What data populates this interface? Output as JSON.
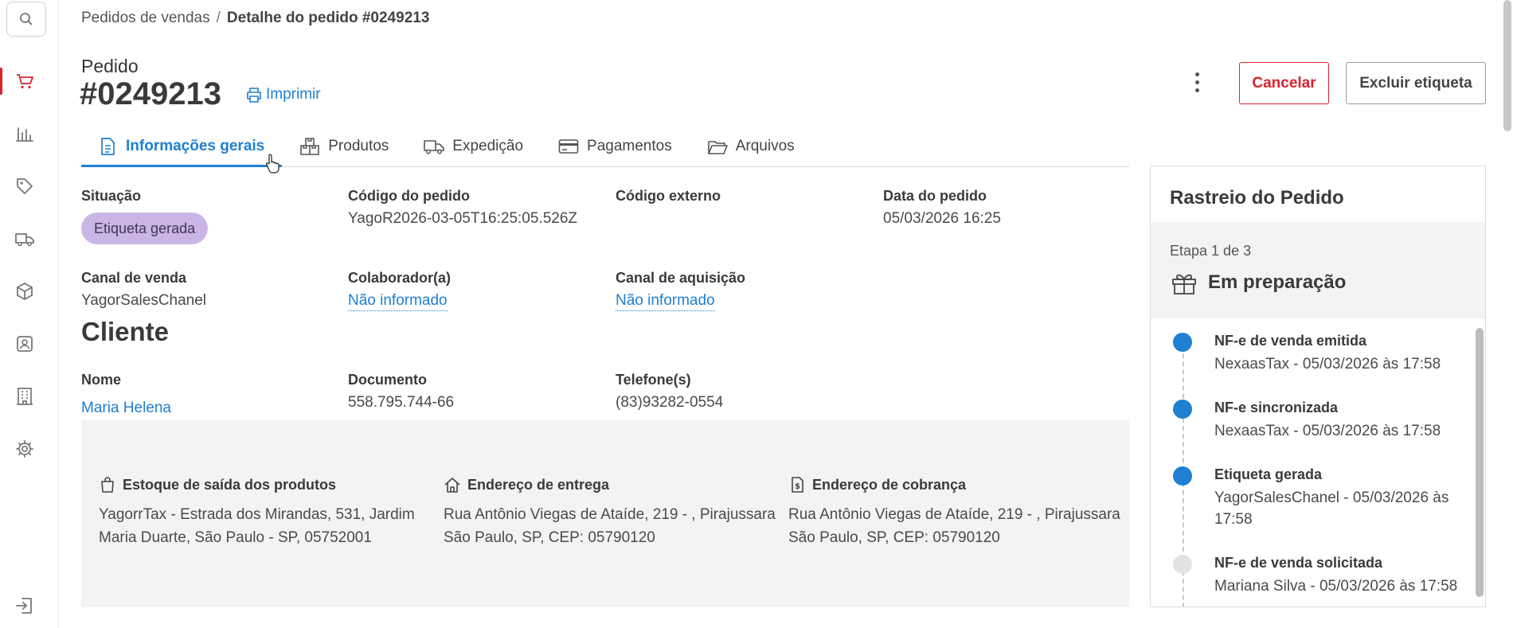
{
  "breadcrumb": {
    "parent": "Pedidos de vendas",
    "separator": "/",
    "current": "Detalhe do pedido #0249213"
  },
  "header": {
    "label": "Pedido",
    "number": "#0249213",
    "print_label": "Imprimir",
    "cancel_label": "Cancelar",
    "delete_label_button": "Excluir etiqueta"
  },
  "tabs": [
    {
      "label": "Informações gerais",
      "icon": "document-icon",
      "active": true
    },
    {
      "label": "Produtos",
      "icon": "boxes-icon",
      "active": false
    },
    {
      "label": "Expedição",
      "icon": "truck-icon",
      "active": false
    },
    {
      "label": "Pagamentos",
      "icon": "card-icon",
      "active": false
    },
    {
      "label": "Arquivos",
      "icon": "folder-icon",
      "active": false
    }
  ],
  "info": {
    "situacao_label": "Situação",
    "situacao_value": "Etiqueta gerada",
    "codigo_label": "Código do pedido",
    "codigo_value": "YagoR2026-03-05T16:25:05.526Z",
    "codigo_externo_label": "Código externo",
    "data_label": "Data do pedido",
    "data_value": "05/03/2026 16:25",
    "canal_venda_label": "Canal de venda",
    "canal_venda_value": "YagorSalesChanel",
    "colaborador_label": "Colaborador(a)",
    "colaborador_value": "Não informado",
    "canal_aquisicao_label": "Canal de aquisição",
    "canal_aquisicao_value": "Não informado",
    "status_color": "#c9b6e4"
  },
  "cliente": {
    "title": "Cliente",
    "nome_label": "Nome",
    "nome_value": "Maria Helena",
    "documento_label": "Documento",
    "documento_value": "558.795.744-66",
    "telefone_label": "Telefone(s)",
    "telefone_value": "(83)93282-0554"
  },
  "addresses": {
    "estoque_title": "Estoque de saída dos produtos",
    "estoque_text": "YagorrTax - Estrada dos Mirandas, 531, Jardim Maria Duarte, São Paulo - SP, 05752001",
    "entrega_title": "Endereço de entrega",
    "entrega_text": "Rua Antônio Viegas de Ataíde, 219 - , Pirajussara São Paulo, SP, CEP: 05790120",
    "cobranca_title": "Endereço de cobrança",
    "cobranca_text": "Rua Antônio Viegas de Ataíde, 219 - , Pirajussara São Paulo, SP, CEP: 05790120"
  },
  "tracking": {
    "title": "Rastreio do Pedido",
    "stage_count": "Etapa 1 de 3",
    "stage_name": "Em preparação",
    "events": [
      {
        "title": "NF-e de venda emitida",
        "subtitle": "NexaasTax - 05/03/2026 às 17:58",
        "done": true
      },
      {
        "title": "NF-e sincronizada",
        "subtitle": "NexaasTax - 05/03/2026 às 17:58",
        "done": true
      },
      {
        "title": "Etiqueta gerada",
        "subtitle": "YagorSalesChanel - 05/03/2026 às 17:58",
        "done": true
      },
      {
        "title": "NF-e de venda solicitada",
        "subtitle": "Mariana Silva - 05/03/2026 às 17:58",
        "done": false
      }
    ]
  },
  "sidebar": {
    "items": [
      {
        "icon": "search-icon"
      },
      {
        "icon": "cart-icon",
        "active": true
      },
      {
        "icon": "bar-chart-icon"
      },
      {
        "icon": "tag-icon"
      },
      {
        "icon": "truck-icon"
      },
      {
        "icon": "box-icon"
      },
      {
        "icon": "user-badge-icon"
      },
      {
        "icon": "building-icon"
      },
      {
        "icon": "gear-icon"
      },
      {
        "icon": "logout-icon"
      }
    ]
  },
  "colors": {
    "accent": "#1f7fd1",
    "danger": "#d9232d",
    "panel_bg": "#f3f3f3"
  }
}
